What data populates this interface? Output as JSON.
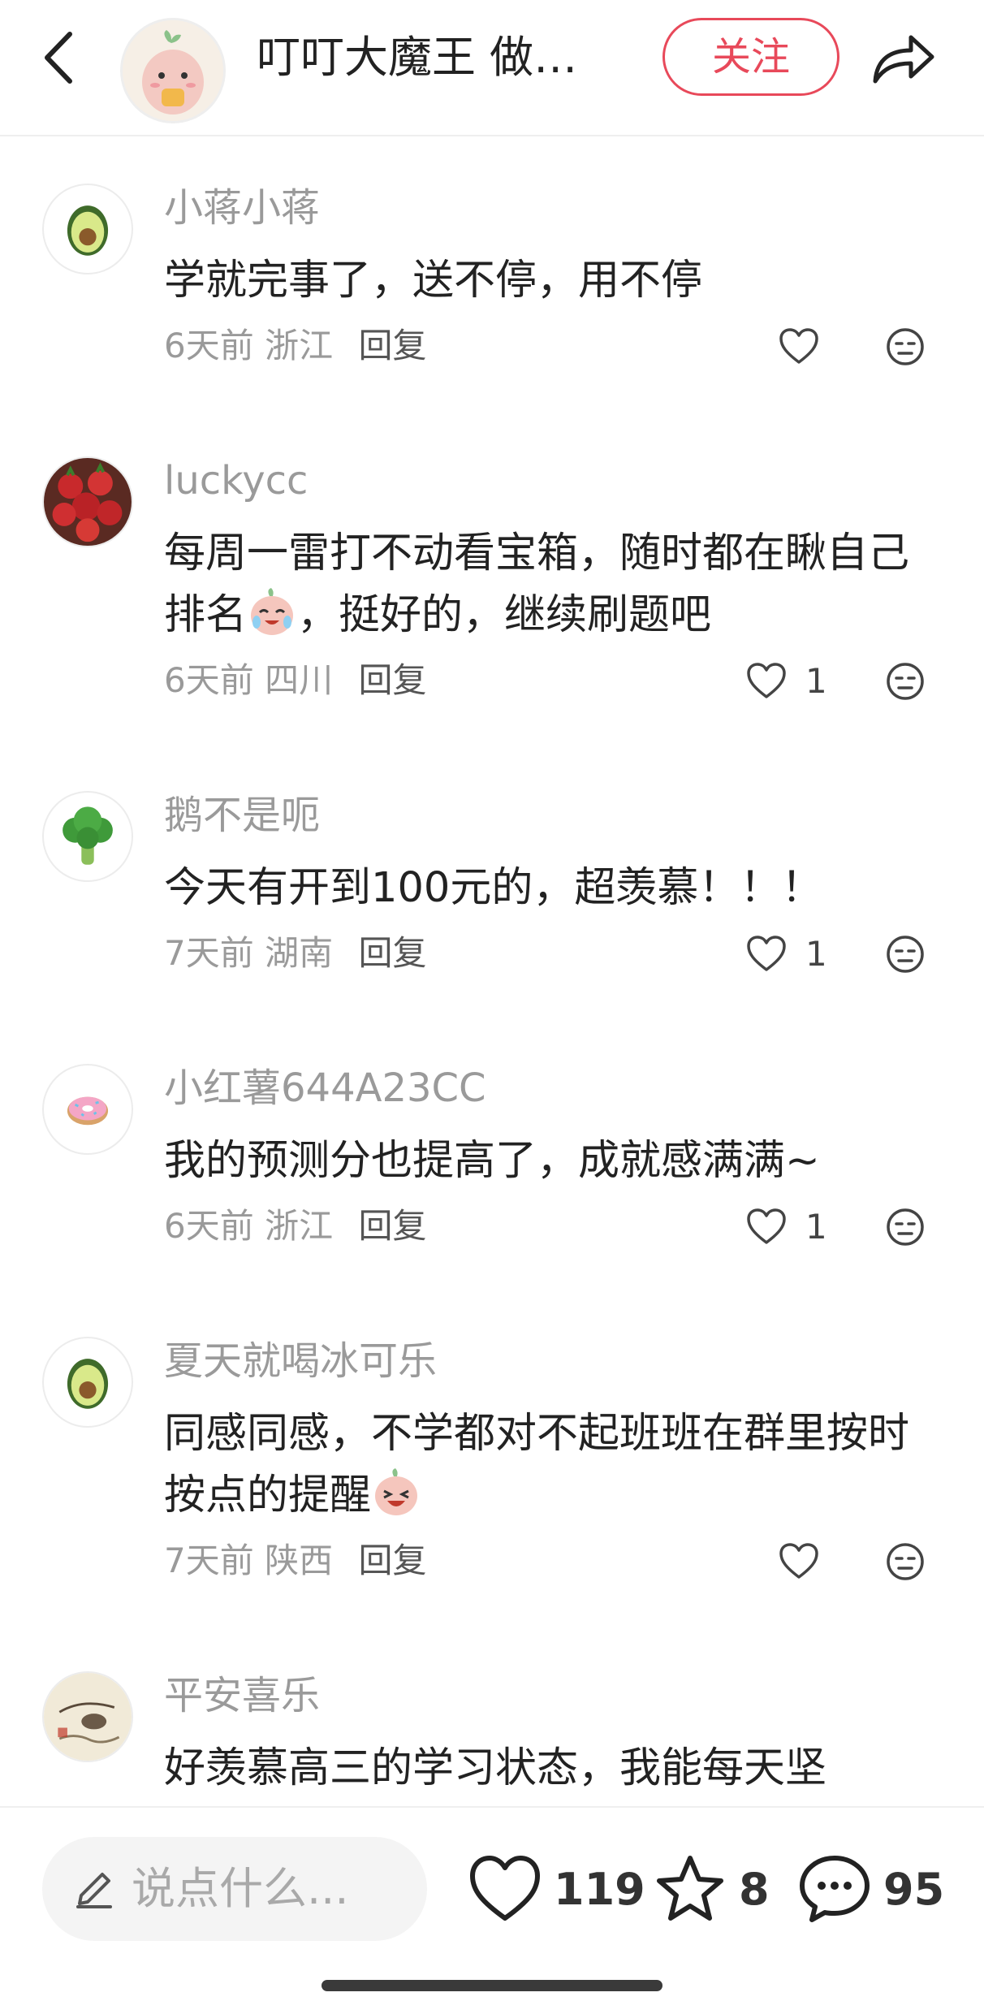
{
  "header": {
    "author_name": "叮叮大魔王 做…",
    "follow_label": "关注"
  },
  "comments": [
    {
      "name": "小蒋小蒋",
      "text": "学就完事了，送不停，用不停",
      "time": "6天前",
      "location": "浙江",
      "reply": "回复",
      "likes": "",
      "avatar_icon": "avocado"
    },
    {
      "name": "luckycc",
      "text_a": "每周一雷打不动看宝箱，随时都在瞅自己排名",
      "text_b": "，挺好的，继续刷题吧",
      "time": "6天前",
      "location": "四川",
      "reply": "回复",
      "likes": "1",
      "avatar_icon": "strawberries"
    },
    {
      "name": "鹅不是呃",
      "text": "今天有开到100元的，超羡慕！！！",
      "time": "7天前",
      "location": "湖南",
      "reply": "回复",
      "likes": "1",
      "avatar_icon": "broccoli"
    },
    {
      "name": "小红薯644A23CC",
      "text": "我的预测分也提高了，成就感满满~",
      "time": "6天前",
      "location": "浙江",
      "reply": "回复",
      "likes": "1",
      "avatar_icon": "donut"
    },
    {
      "name": "夏天就喝冰可乐",
      "text": "同感同感，不学都对不起班班在群里按时按点的提醒",
      "time": "7天前",
      "location": "陕西",
      "reply": "回复",
      "likes": "",
      "avatar_icon": "avocado"
    },
    {
      "name": "平安喜乐",
      "text": "好羡慕高三的学习状态，我能每天坚",
      "avatar_icon": "ink-painting"
    }
  ],
  "bottom": {
    "input_placeholder": "说点什么...",
    "like_count": "119",
    "star_count": "8",
    "comment_count": "95"
  }
}
